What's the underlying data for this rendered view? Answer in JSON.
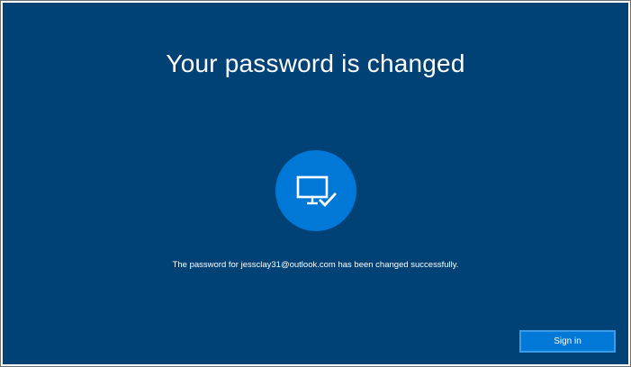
{
  "screen": {
    "title": "Your password is changed",
    "icon": "monitor-check-icon",
    "message": "The password for jessclay31@outlook.com has been changed successfully.",
    "sign_in_label": "Sign in"
  },
  "colors": {
    "background": "#004275",
    "accent": "#0078d7",
    "text": "#ffffff"
  }
}
